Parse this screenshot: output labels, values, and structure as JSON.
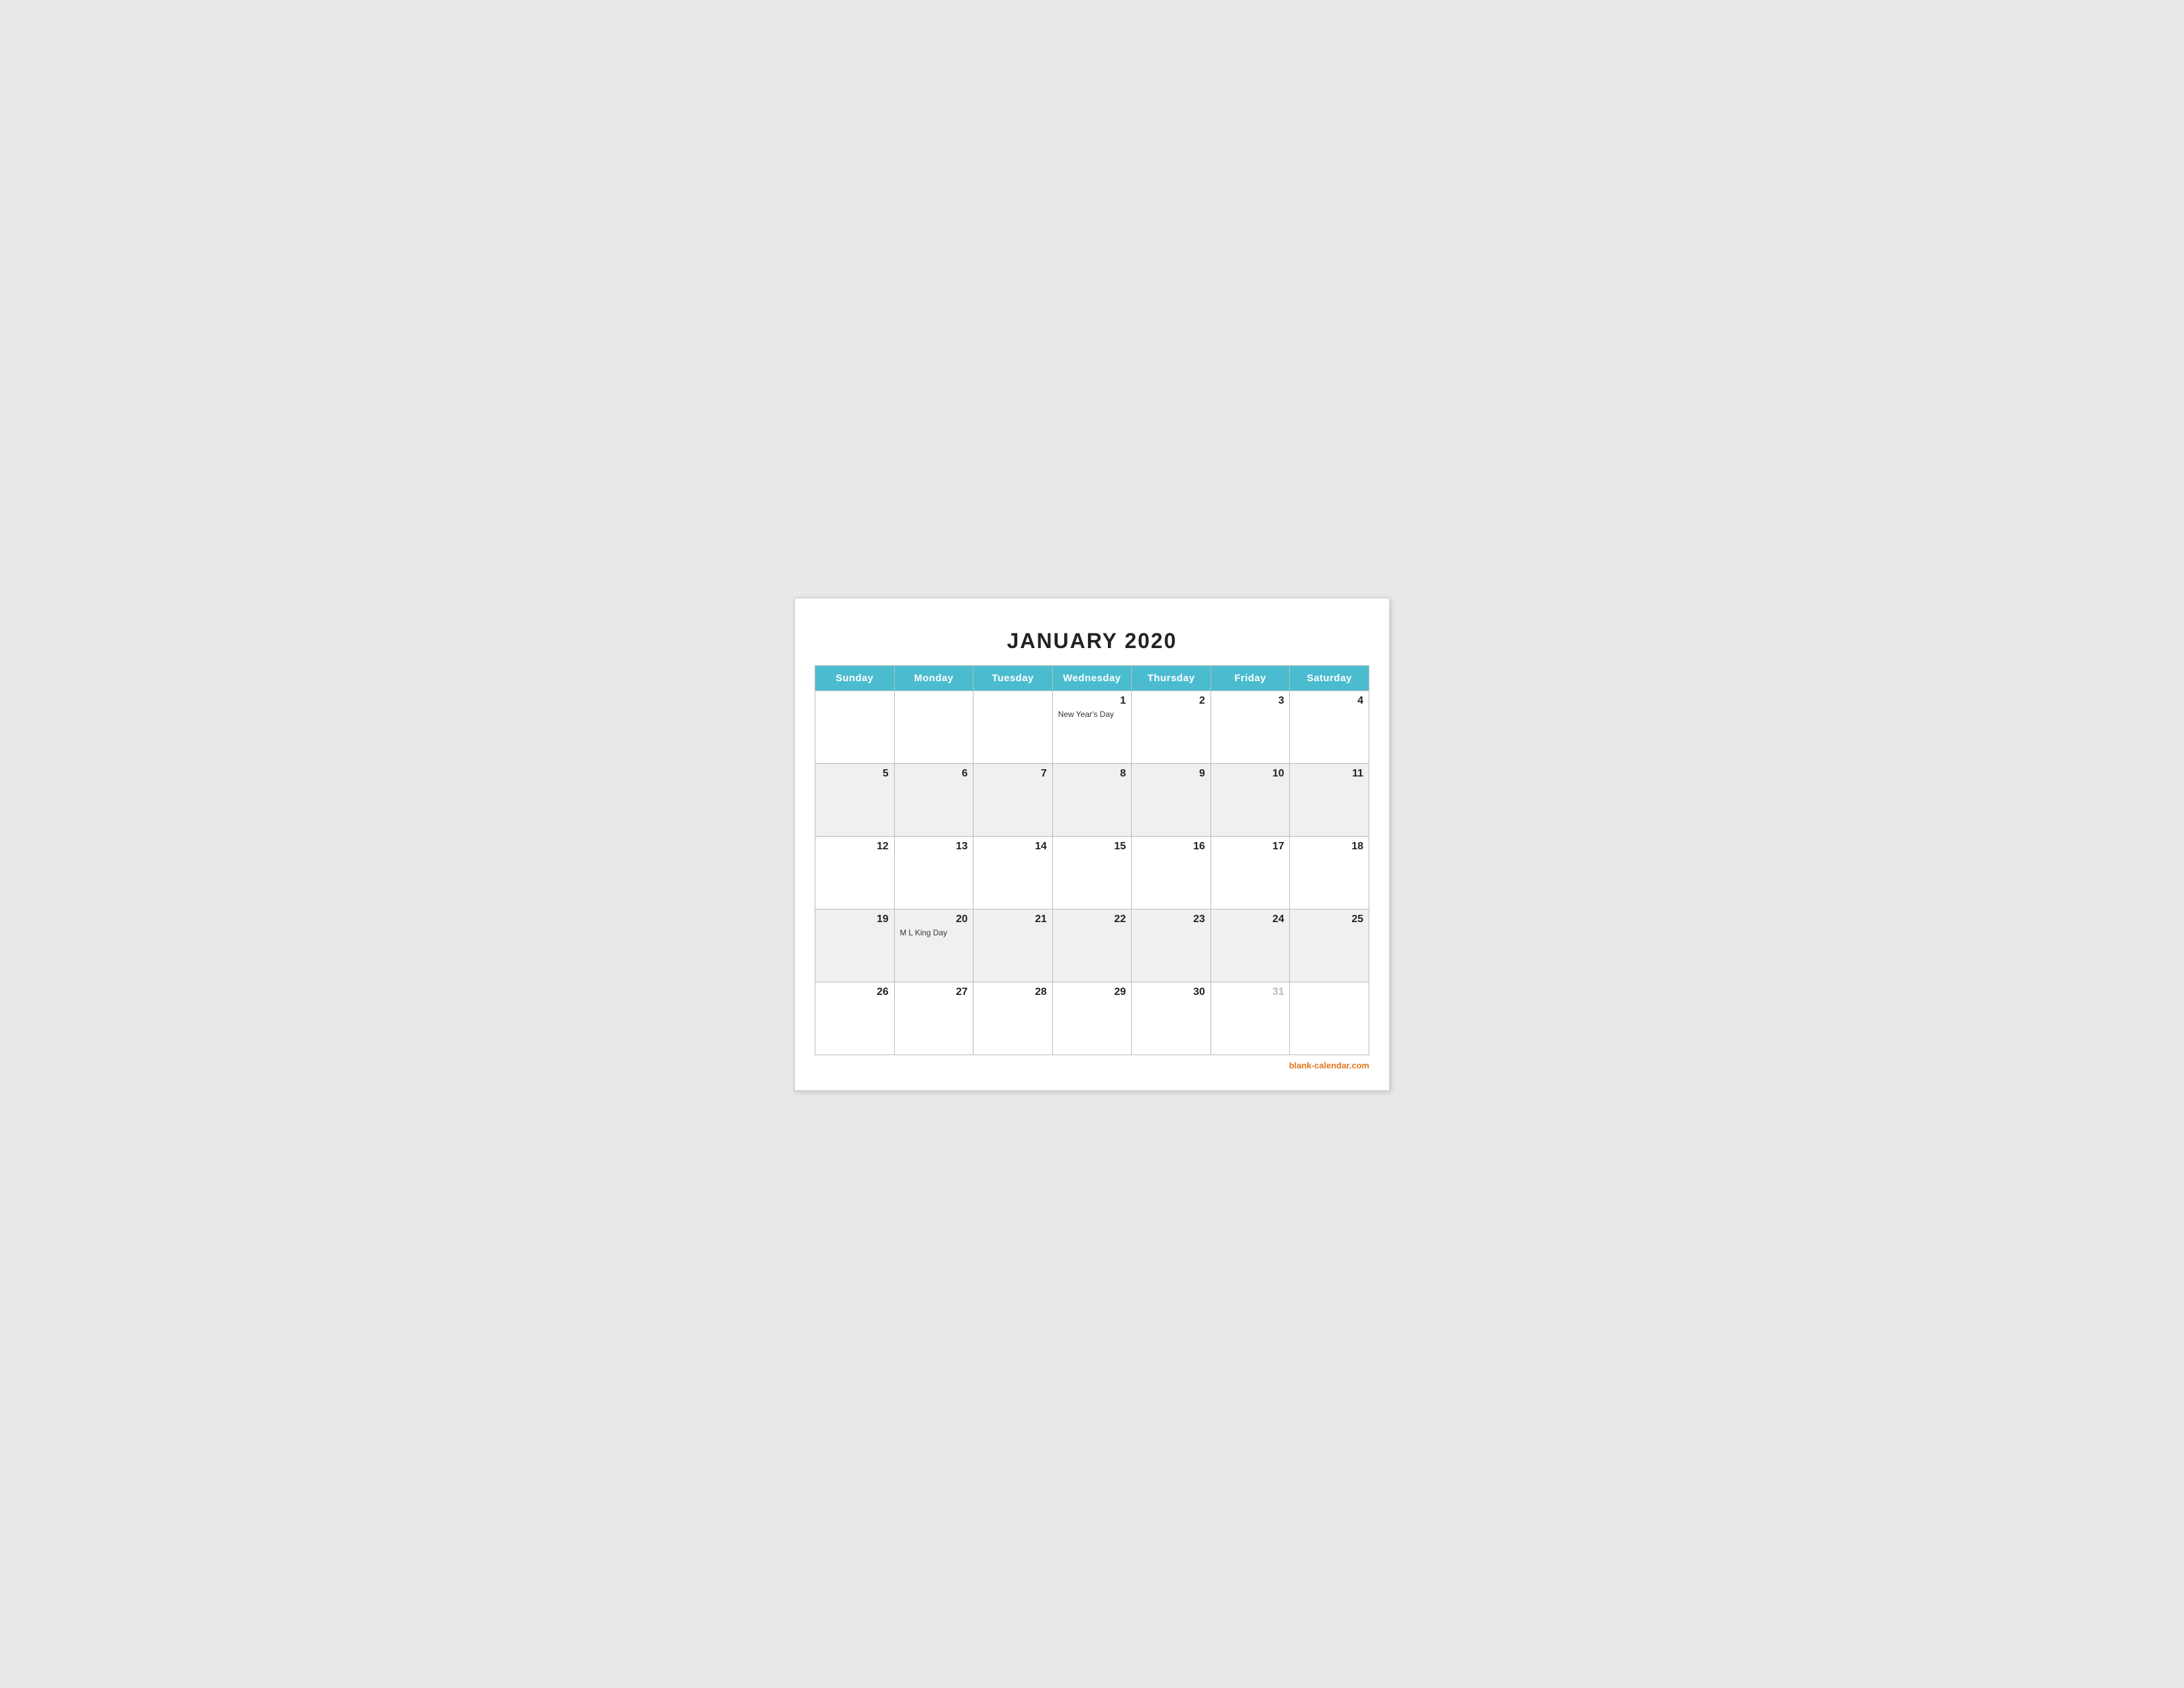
{
  "title": "JANUARY 2020",
  "days": {
    "headers": [
      "Sunday",
      "Monday",
      "Tuesday",
      "Wednesday",
      "Thursday",
      "Friday",
      "Saturday"
    ]
  },
  "weeks": [
    {
      "shade": "white",
      "cells": [
        {
          "date": "",
          "event": ""
        },
        {
          "date": "",
          "event": ""
        },
        {
          "date": "",
          "event": ""
        },
        {
          "date": "1",
          "event": "New Year's Day"
        },
        {
          "date": "2",
          "event": ""
        },
        {
          "date": "3",
          "event": ""
        },
        {
          "date": "4",
          "event": ""
        }
      ]
    },
    {
      "shade": "gray",
      "cells": [
        {
          "date": "5",
          "event": ""
        },
        {
          "date": "6",
          "event": ""
        },
        {
          "date": "7",
          "event": ""
        },
        {
          "date": "8",
          "event": ""
        },
        {
          "date": "9",
          "event": ""
        },
        {
          "date": "10",
          "event": ""
        },
        {
          "date": "11",
          "event": ""
        }
      ]
    },
    {
      "shade": "white",
      "cells": [
        {
          "date": "12",
          "event": ""
        },
        {
          "date": "13",
          "event": ""
        },
        {
          "date": "14",
          "event": ""
        },
        {
          "date": "15",
          "event": ""
        },
        {
          "date": "16",
          "event": ""
        },
        {
          "date": "17",
          "event": ""
        },
        {
          "date": "18",
          "event": ""
        }
      ]
    },
    {
      "shade": "gray",
      "cells": [
        {
          "date": "19",
          "event": ""
        },
        {
          "date": "20",
          "event": "M L King Day"
        },
        {
          "date": "21",
          "event": ""
        },
        {
          "date": "22",
          "event": ""
        },
        {
          "date": "23",
          "event": ""
        },
        {
          "date": "24",
          "event": ""
        },
        {
          "date": "25",
          "event": ""
        }
      ]
    },
    {
      "shade": "white",
      "cells": [
        {
          "date": "26",
          "event": ""
        },
        {
          "date": "27",
          "event": ""
        },
        {
          "date": "28",
          "event": ""
        },
        {
          "date": "29",
          "event": ""
        },
        {
          "date": "30",
          "event": ""
        },
        {
          "date": "31",
          "event": "",
          "muted": true
        },
        {
          "date": "",
          "event": ""
        }
      ]
    }
  ],
  "footer": "blank-calendar.com"
}
